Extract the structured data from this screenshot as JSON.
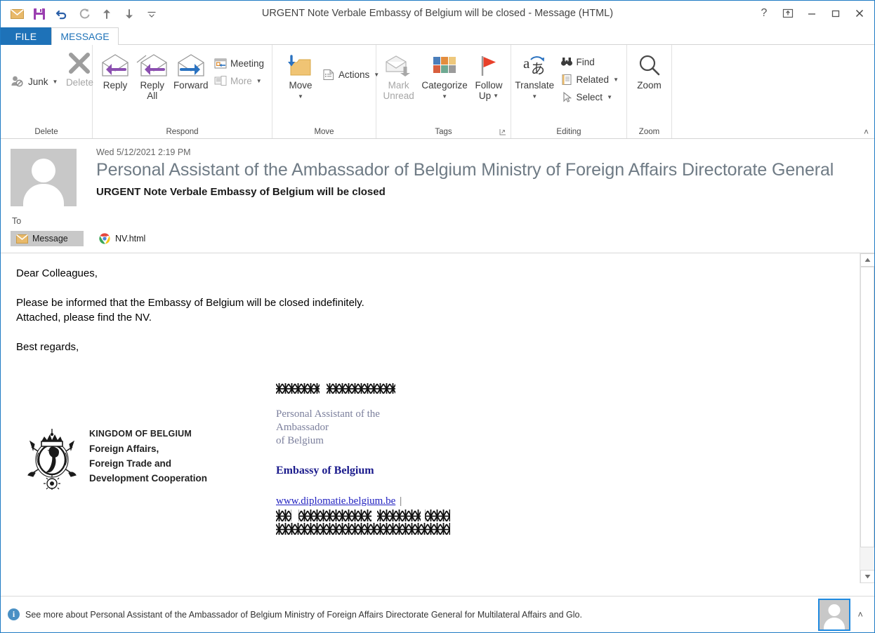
{
  "window": {
    "title": "URGENT Note Verbale Embassy of Belgium will be closed - Message (HTML)",
    "help_label": "?",
    "restore_label": "❐",
    "minimize_label": "─",
    "maximize_label": "□",
    "close_label": "✕",
    "accent_color": "#1f7ac4"
  },
  "quick_access": {
    "items": [
      {
        "name": "mail-icon",
        "label": "Mail"
      },
      {
        "name": "save-icon",
        "label": "Save"
      },
      {
        "name": "undo-icon",
        "label": "Undo"
      },
      {
        "name": "redo-icon",
        "label": "Redo"
      },
      {
        "name": "previous-item-icon",
        "label": "Previous Item"
      },
      {
        "name": "next-item-icon",
        "label": "Next Item"
      },
      {
        "name": "customize-qat-icon",
        "label": "Customize Quick Access Toolbar"
      }
    ]
  },
  "tabs": {
    "file": "FILE",
    "message": "MESSAGE"
  },
  "ribbon": {
    "collapse_label": "˄",
    "groups": [
      {
        "label": "Delete",
        "junk": "Junk",
        "delete": "Delete"
      },
      {
        "label": "Respond",
        "reply": "Reply",
        "reply_all_line1": "Reply",
        "reply_all_line2": "All",
        "forward": "Forward",
        "meeting": "Meeting",
        "more": "More"
      },
      {
        "label": "Move",
        "move": "Move",
        "actions": "Actions"
      },
      {
        "label": "Tags",
        "mark_unread_line1": "Mark",
        "mark_unread_line2": "Unread",
        "categorize": "Categorize",
        "follow_up_line1": "Follow",
        "follow_up_line2": "Up",
        "dialog_launcher": "⤵"
      },
      {
        "label": "Editing",
        "translate": "Translate",
        "find": "Find",
        "related": "Related",
        "select": "Select"
      },
      {
        "label": "Zoom",
        "zoom": "Zoom"
      }
    ],
    "categorize_colors": [
      "#4a7ebb",
      "#e38d3e",
      "#eec87c",
      "#d85f3e",
      "#6fa992",
      "#9b9b9b"
    ],
    "flag_color": "#e8402a",
    "folder_color": "#f0c474",
    "envelope_color": "#e8b96a",
    "arrow_purple": "#8b4fb0",
    "arrow_blue": "#2a72c0"
  },
  "message": {
    "date": "Wed 5/12/2021 2:19 PM",
    "sender": "Personal Assistant of the Ambassador of Belgium Ministry of Foreign Affairs Directorate General",
    "subject": "URGENT Note Verbale Embassy of Belgium will be closed",
    "to_label": "To",
    "attachments": {
      "message_tab": "Message",
      "files": [
        {
          "name": "NV.html",
          "icon": "chrome-icon"
        }
      ]
    }
  },
  "body": {
    "greeting": "Dear Colleagues,",
    "paragraph_line1": "Please be informed that the Embassy of Belgium will be closed indefinitely.",
    "paragraph_line2": "Attached, please find the NV.",
    "closing": "Best regards,"
  },
  "signature": {
    "logo": {
      "line1": "KINGDOM OF BELGIUM",
      "line2": "Foreign Affairs,",
      "line3": "Foreign Trade and",
      "line4": "Development Cooperation"
    },
    "name_redacted": "[redacted sender name]",
    "role_line1": "Personal Assistant of the",
    "role_line2": "Ambassador",
    "role_line3": "of Belgium",
    "organization": "Embassy of Belgium",
    "website": "www.diplomatie.belgium.be",
    "separator": "|",
    "contact_redacted_line1": "[redacted contact line 1]",
    "contact_redacted_line2": "[redacted contact line 2]"
  },
  "scrollbar": {
    "up_arrow": "▲",
    "down_arrow": "▼"
  },
  "status": {
    "info_icon": "i",
    "text": "See more about Personal Assistant of the Ambassador of Belgium Ministry of Foreign Affairs Directorate General for Multilateral Affairs and Glo.",
    "expand_label": "˄"
  }
}
